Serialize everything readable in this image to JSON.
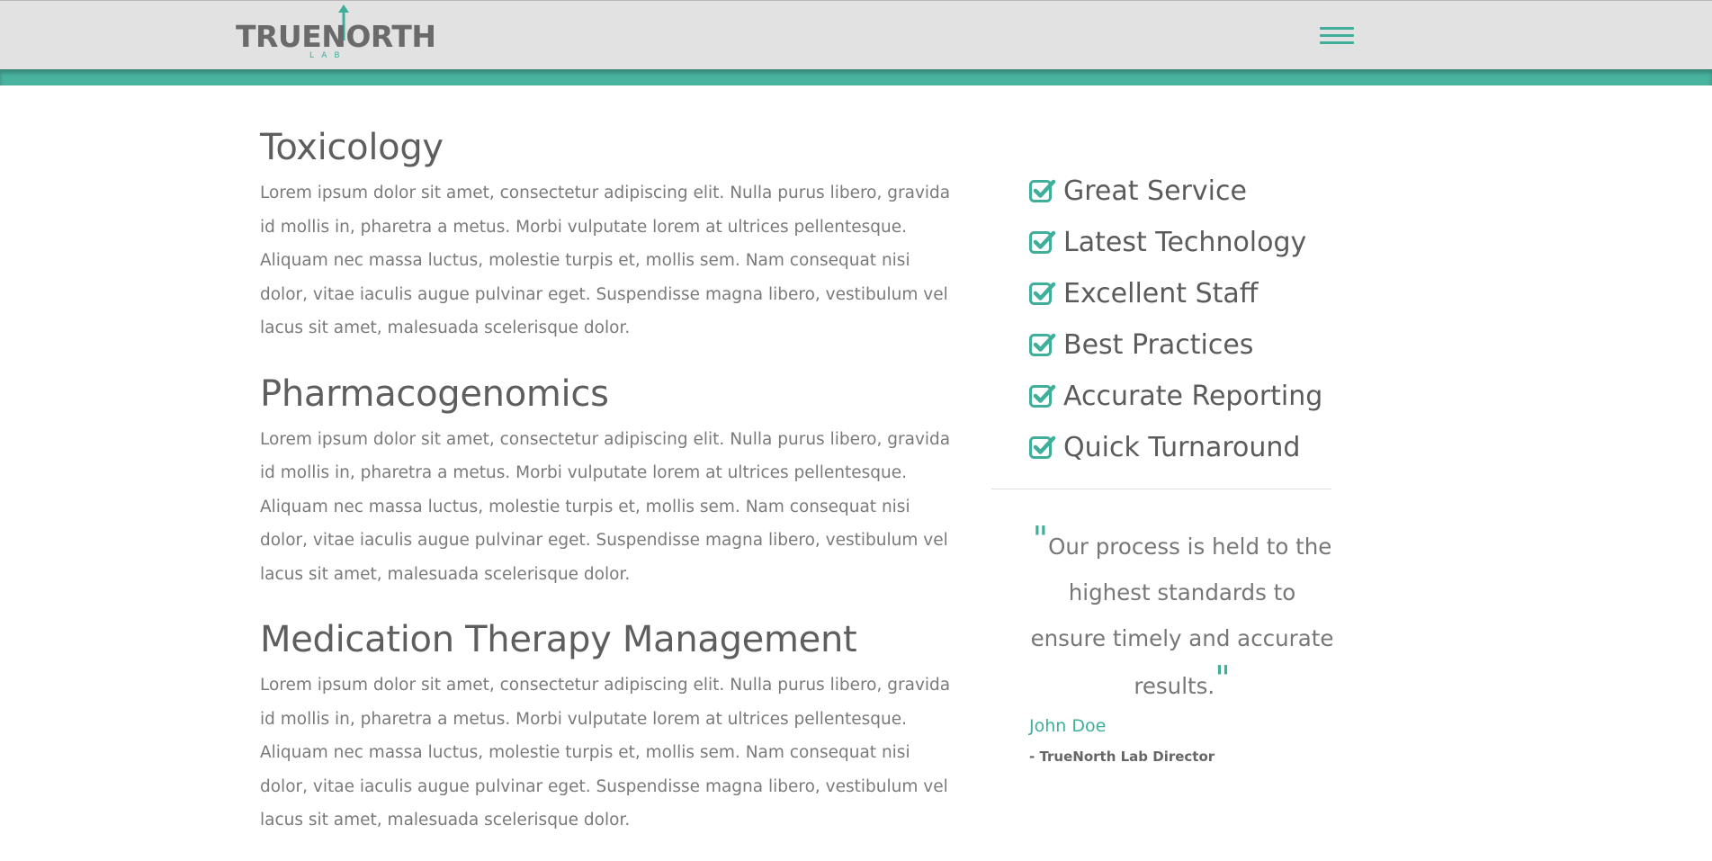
{
  "colors": {
    "accent": "#3fae9b",
    "nav_background": "#e2e2e2",
    "heading": "#5e5e5e",
    "body_text": "#7a7a7a"
  },
  "header": {
    "logo_text": "TRUENORTH",
    "logo_subtext": "LAB",
    "menu_icon": "hamburger-menu-icon"
  },
  "main": {
    "sections": [
      {
        "title": "Toxicology",
        "body": "Lorem ipsum dolor sit amet, consectetur adipiscing elit. Nulla purus libero, gravida id mollis in, pharetra a metus. Morbi vulputate lorem at ultrices pellentesque. Aliquam nec massa luctus, molestie turpis et, mollis sem. Nam consequat nisi dolor, vitae iaculis augue pulvinar eget. Suspendisse magna libero, vestibulum vel lacus sit amet, malesuada scelerisque dolor."
      },
      {
        "title": "Pharmacogenomics",
        "body": "Lorem ipsum dolor sit amet, consectetur adipiscing elit. Nulla purus libero, gravida id mollis in, pharetra a metus. Morbi vulputate lorem at ultrices pellentesque. Aliquam nec massa luctus, molestie turpis et, mollis sem. Nam consequat nisi dolor, vitae iaculis augue pulvinar eget. Suspendisse magna libero, vestibulum vel lacus sit amet, malesuada scelerisque dolor."
      },
      {
        "title": "Medication Therapy Management",
        "body": "Lorem ipsum dolor sit amet, consectetur adipiscing elit. Nulla purus libero, gravida id mollis in, pharetra a metus. Morbi vulputate lorem at ultrices pellentesque. Aliquam nec massa luctus, molestie turpis et, mollis sem. Nam consequat nisi dolor, vitae iaculis augue pulvinar eget. Suspendisse magna libero, vestibulum vel lacus sit amet, malesuada scelerisque dolor."
      }
    ]
  },
  "sidebar": {
    "features": [
      {
        "icon": "check-square-icon",
        "label": "Great Service"
      },
      {
        "icon": "check-square-icon",
        "label": "Latest Technology"
      },
      {
        "icon": "check-square-icon",
        "label": "Excellent Staff"
      },
      {
        "icon": "check-square-icon",
        "label": "Best Practices"
      },
      {
        "icon": "check-square-icon",
        "label": "Accurate Reporting"
      },
      {
        "icon": "check-square-icon",
        "label": "Quick Turnaround"
      }
    ],
    "testimonial": {
      "quote": "Our process is held to the highest standards to ensure timely and accurate results.",
      "author": "John Doe",
      "role": "- TrueNorth Lab Director"
    }
  }
}
